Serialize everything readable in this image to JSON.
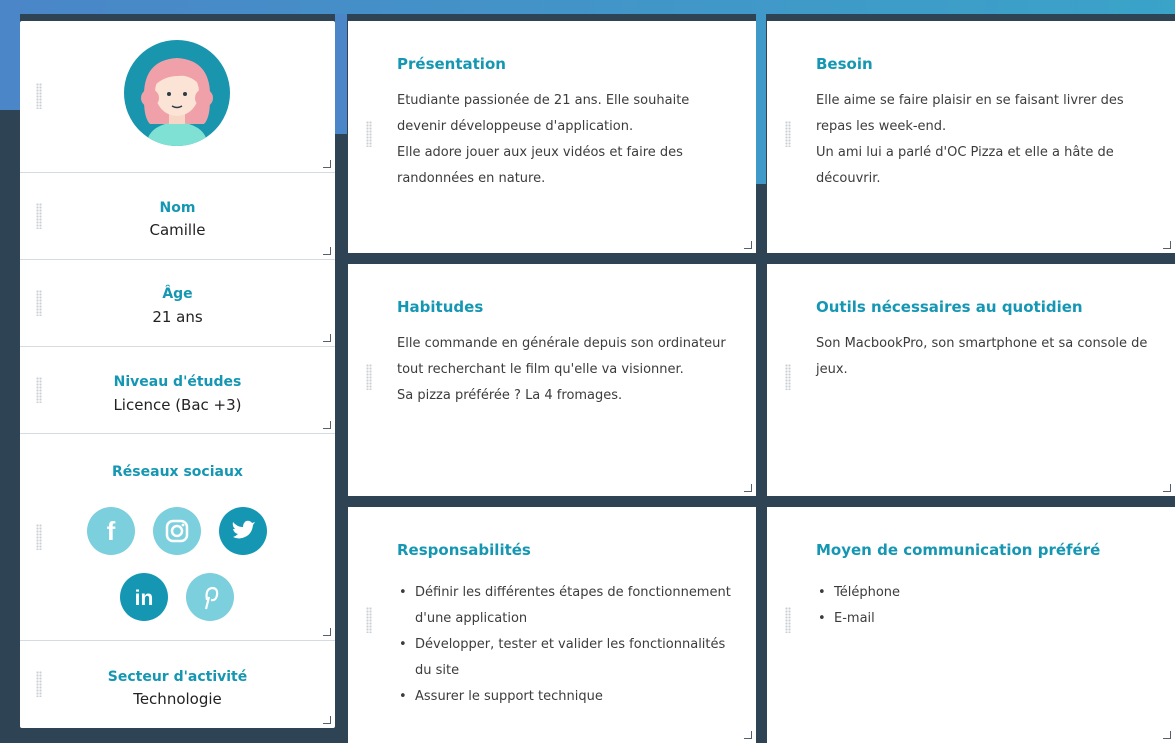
{
  "profile": {
    "name_label": "Nom",
    "name_value": "Camille",
    "age_label": "Âge",
    "age_value": "21 ans",
    "education_label": "Niveau d'études",
    "education_value": "Licence (Bac +3)",
    "social_label": "Réseaux sociaux",
    "social_icons": [
      "facebook-icon",
      "instagram-icon",
      "twitter-icon",
      "linkedin-icon",
      "pinterest-icon"
    ],
    "sector_label": "Secteur d'activité",
    "sector_value": "Technologie"
  },
  "cards": {
    "presentation": {
      "title": "Présentation",
      "lines": [
        "Etudiante passionée de 21 ans. Elle souhaite devenir développeuse d'application.",
        "Elle adore jouer aux jeux vidéos et faire des randonnées en nature."
      ]
    },
    "besoin": {
      "title": "Besoin",
      "lines": [
        "Elle aime se faire plaisir en se faisant livrer des repas les week-end.",
        "Un ami lui a parlé d'OC Pizza et elle a hâte de découvrir."
      ]
    },
    "habitudes": {
      "title": "Habitudes",
      "lines": [
        "Elle commande en générale depuis son ordinateur tout recherchant le film qu'elle va visionner.",
        "Sa pizza préférée ? La 4 fromages."
      ]
    },
    "outils": {
      "title": "Outils nécessaires au quotidien",
      "lines": [
        "Son MacbookPro, son smartphone et sa console de jeux."
      ]
    },
    "responsabilites": {
      "title": "Responsabilités",
      "items": [
        "Définir les différentes étapes de fonctionnement d'une application",
        "Développer, tester et valider les fonctionnalités du site",
        "Assurer le support technique"
      ]
    },
    "communication": {
      "title": "Moyen de communication préféré",
      "items": [
        "Téléphone",
        "E-mail"
      ]
    }
  },
  "colors": {
    "accent": "#1597b3",
    "accent_light": "#7ccfdc",
    "background": "#2e4455",
    "banner": "#4a86c8"
  }
}
